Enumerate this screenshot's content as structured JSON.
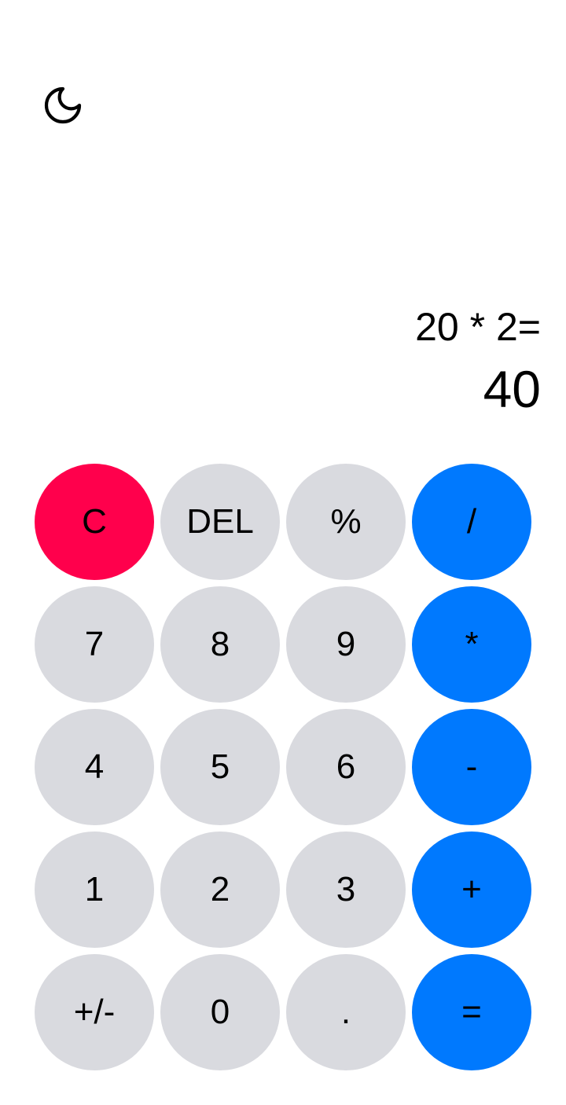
{
  "theme_icon": "moon-icon",
  "display": {
    "expression": "20 * 2=",
    "result": "40"
  },
  "colors": {
    "number_key": "#d9dadf",
    "operator_key": "#0079fe",
    "clear_key": "#ff004c"
  },
  "keys": {
    "clear": "C",
    "delete": "DEL",
    "percent": "%",
    "divide": "/",
    "seven": "7",
    "eight": "8",
    "nine": "9",
    "multiply": "*",
    "four": "4",
    "five": "5",
    "six": "6",
    "minus": "-",
    "one": "1",
    "two": "2",
    "three": "3",
    "plus": "+",
    "negate": "+/-",
    "zero": "0",
    "decimal": ".",
    "equals": "="
  }
}
